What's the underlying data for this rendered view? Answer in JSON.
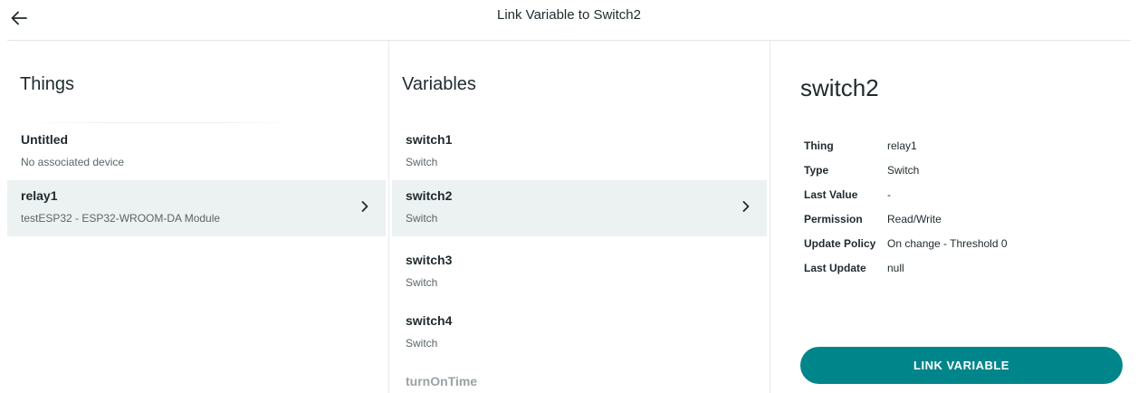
{
  "header": {
    "title": "Link Variable to Switch2",
    "back_icon": "arrow-left-icon"
  },
  "things": {
    "heading": "Things",
    "items": [
      {
        "name": "Untitled",
        "sub": "No associated device",
        "selected": false
      },
      {
        "name": "relay1",
        "sub": "testESP32 - ESP32-WROOM-DA Module",
        "selected": true
      }
    ]
  },
  "variables": {
    "heading": "Variables",
    "items": [
      {
        "name": "switch1",
        "sub": "Switch",
        "selected": false
      },
      {
        "name": "switch2",
        "sub": "Switch",
        "selected": true
      },
      {
        "name": "switch3",
        "sub": "Switch",
        "selected": false
      },
      {
        "name": "switch4",
        "sub": "Switch",
        "selected": false
      },
      {
        "name": "turnOnTime",
        "sub": "",
        "selected": false
      }
    ]
  },
  "detail": {
    "title": "switch2",
    "rows": [
      {
        "label": "Thing",
        "value": "relay1"
      },
      {
        "label": "Type",
        "value": "Switch"
      },
      {
        "label": "Last Value",
        "value": "-"
      },
      {
        "label": "Permission",
        "value": "Read/Write"
      },
      {
        "label": "Update Policy",
        "value": "On change - Threshold 0"
      },
      {
        "label": "Last Update",
        "value": "null"
      }
    ],
    "button_label": "LINK VARIABLE"
  },
  "colors": {
    "accent": "#00868a",
    "selected_row": "#ecf1f1"
  }
}
